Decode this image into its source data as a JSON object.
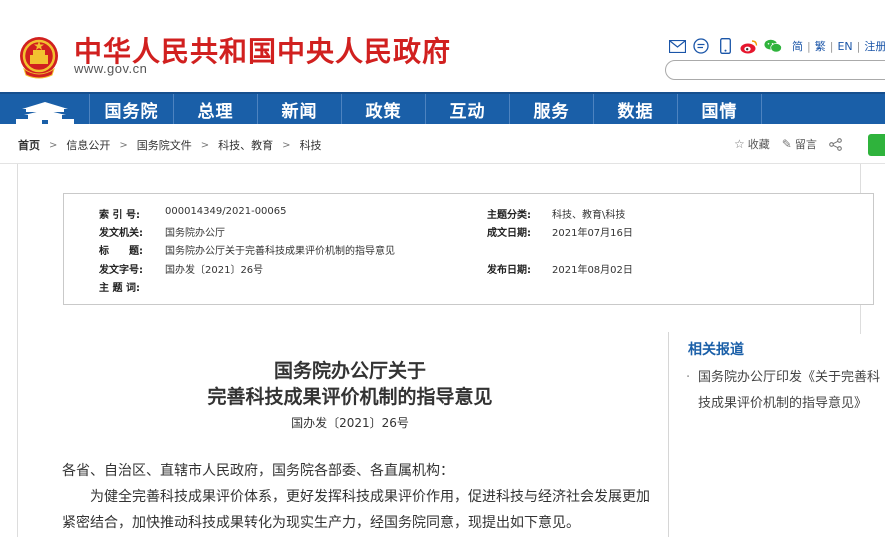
{
  "header": {
    "site_title": "中华人民共和国中央人民政府",
    "site_url": "www.gov.cn",
    "icons": [
      "mail-icon",
      "comment-icon",
      "mobile-icon",
      "weibo-icon",
      "wechat-icon"
    ],
    "lang_links": [
      "简",
      "繁",
      "EN",
      "注册"
    ],
    "search_placeholder": ""
  },
  "nav": {
    "items": [
      "国务院",
      "总理",
      "新闻",
      "政策",
      "互动",
      "服务",
      "数据",
      "国情"
    ]
  },
  "breadcrumb": {
    "items": [
      "首页",
      "信息公开",
      "国务院文件",
      "科技、教育",
      "科技"
    ]
  },
  "actions": {
    "favorite": "收藏",
    "comment": "留言"
  },
  "meta": {
    "index_label": "索 引 号:",
    "index_value": "000014349/2021-00065",
    "topic_label": "主题分类:",
    "topic_value": "科技、教育\\科技",
    "issuer_label": "发文机关:",
    "issuer_value": "国务院办公厅",
    "created_label": "成文日期:",
    "created_value": "2021年07月16日",
    "title_label": "标　　题:",
    "title_value": "国务院办公厅关于完善科技成果评价机制的指导意见",
    "docno_label": "发文字号:",
    "docno_value": "国办发〔2021〕26号",
    "published_label": "发布日期:",
    "published_value": "2021年08月02日",
    "keywords_label": "主 题 词:",
    "keywords_value": ""
  },
  "article": {
    "title_line1": "国务院办公厅关于",
    "title_line2": "完善科技成果评价机制的指导意见",
    "doc_number": "国办发〔2021〕26号",
    "salutation": "各省、自治区、直辖市人民政府，国务院各部委、各直属机构：",
    "paragraph1": "　　为健全完善科技成果评价体系，更好发挥科技成果评价作用，促进科技与经济社会发展更加紧密结合，加快推动科技成果转化为现实生产力，经国务院同意，现提出如下意见。"
  },
  "related": {
    "title": "相关报道",
    "items": [
      "国务院办公厅印发《关于完善科技成果评价机制的指导意见》"
    ]
  },
  "colors": {
    "brand_red": "#d1201f",
    "nav_blue": "#1a5fa8",
    "link_blue": "#1a55a8"
  }
}
